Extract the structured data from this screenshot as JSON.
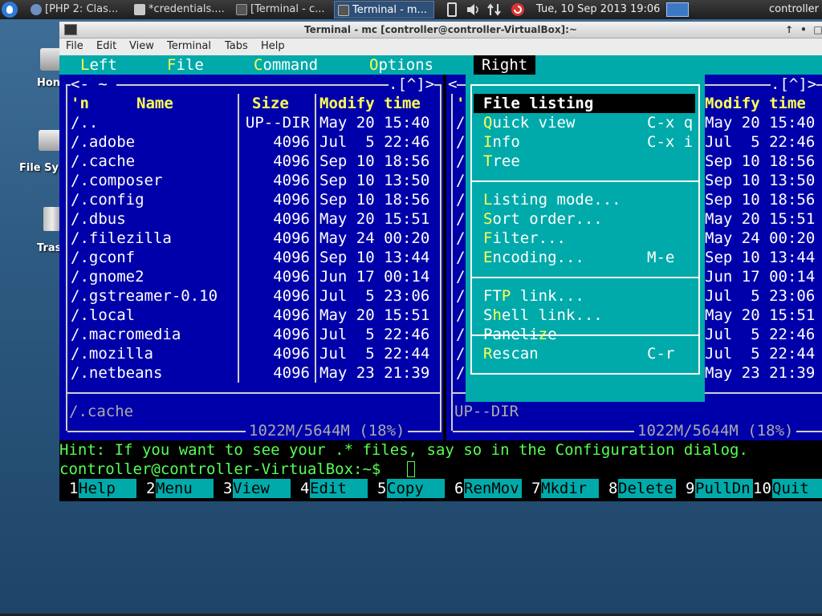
{
  "taskbar": {
    "tasks": [
      {
        "label": "[PHP 2: Clas...",
        "icon_color": "#6e8fbf"
      },
      {
        "label": "*credentials....",
        "icon_color": "#c9c9c9"
      },
      {
        "label": "[Terminal - c...",
        "icon_color": "#555555"
      },
      {
        "label": "Terminal - m...",
        "icon_color": "#555555"
      }
    ],
    "clock": "Tue, 10 Sep 2013 19:06",
    "user": "controller"
  },
  "desktop": {
    "icons": [
      {
        "label": "Hon",
        "icon": "home-folder-icon"
      },
      {
        "label": "File Sy",
        "icon": "drive-icon"
      },
      {
        "label": "Tras",
        "icon": "trash-icon"
      }
    ]
  },
  "window": {
    "title": "Terminal - mc [controller@controller-VirtualBox]:~",
    "menu": [
      "File",
      "Edit",
      "View",
      "Terminal",
      "Tabs",
      "Help"
    ]
  },
  "mc": {
    "menubar": [
      {
        "hot": "L",
        "rest": "eft"
      },
      {
        "hot": "F",
        "rest": "ile"
      },
      {
        "hot": "C",
        "rest": "ommand"
      },
      {
        "hot": "O",
        "rest": "ptions"
      },
      {
        "hot": "",
        "rest": "Right"
      }
    ],
    "left_panel": {
      "header_left": "<- ~ ",
      "header_right": ".[^]>",
      "col_n": "'n",
      "col_name": "Name",
      "col_size": "Size",
      "col_time": "Modify time",
      "files": [
        {
          "name": "/..",
          "size": "UP--DIR",
          "time": "May 20 15:40"
        },
        {
          "name": "/.adobe",
          "size": "4096",
          "time": "Jul  5 22:46"
        },
        {
          "name": "/.cache",
          "size": "4096",
          "time": "Sep 10 18:56"
        },
        {
          "name": "/.composer",
          "size": "4096",
          "time": "Sep 10 13:50"
        },
        {
          "name": "/.config",
          "size": "4096",
          "time": "Sep 10 18:56"
        },
        {
          "name": "/.dbus",
          "size": "4096",
          "time": "May 20 15:51"
        },
        {
          "name": "/.filezilla",
          "size": "4096",
          "time": "May 24 00:20"
        },
        {
          "name": "/.gconf",
          "size": "4096",
          "time": "Sep 10 13:44"
        },
        {
          "name": "/.gnome2",
          "size": "4096",
          "time": "Jun 17 00:14"
        },
        {
          "name": "/.gstreamer-0.10",
          "size": "4096",
          "time": "Jul  5 23:06"
        },
        {
          "name": "/.local",
          "size": "4096",
          "time": "May 20 15:51"
        },
        {
          "name": "/.macromedia",
          "size": "4096",
          "time": "Jul  5 22:46"
        },
        {
          "name": "/.mozilla",
          "size": "4096",
          "time": "Jul  5 22:44"
        },
        {
          "name": "/.netbeans",
          "size": "4096",
          "time": "May 23 21:39"
        }
      ],
      "status": "/.cache",
      "disk": "1022M/5644M (18%)"
    },
    "right_panel": {
      "header_left": "<",
      "header_right": ".[^]>",
      "col_n": "'",
      "col_time": "Modify time",
      "slashes": [
        "/",
        "/",
        "/",
        "/",
        "/",
        "/",
        "/",
        "/",
        "/",
        "/",
        "/",
        "/",
        "/",
        "/"
      ],
      "times": [
        "May 20 15:40",
        "Jul  5 22:46",
        "Sep 10 18:56",
        "Sep 10 13:50",
        "Sep 10 18:56",
        "May 20 15:51",
        "May 24 00:20",
        "Sep 10 13:44",
        "Jun 17 00:14",
        "Jul  5 23:06",
        "May 20 15:51",
        "Jul  5 22:46",
        "Jul  5 22:44",
        "May 23 21:39"
      ],
      "status": "UP--DIR",
      "disk": "1022M/5644M (18%)"
    },
    "dropdown": {
      "groups": [
        [
          {
            "hot": "",
            "pre": "File listin",
            "post": "g",
            "hotmid": "",
            "shortcut": "",
            "selected": true
          },
          {
            "hot": "Q",
            "pre": "",
            "post": "uick view",
            "shortcut": "C-x q"
          },
          {
            "hot": "I",
            "pre": "",
            "post": "nfo",
            "shortcut": "C-x i"
          },
          {
            "hot": "T",
            "pre": "",
            "post": "ree",
            "shortcut": ""
          }
        ],
        [
          {
            "hot": "L",
            "pre": "",
            "post": "isting mode...",
            "shortcut": ""
          },
          {
            "hot": "S",
            "pre": "",
            "post": "ort order...",
            "shortcut": ""
          },
          {
            "hot": "F",
            "pre": "",
            "post": "ilter...",
            "shortcut": ""
          },
          {
            "hot": "E",
            "pre": "",
            "post": "ncoding...",
            "shortcut": "M-e"
          }
        ],
        [
          {
            "hot": "P",
            "pre": "FT",
            "post": " link...",
            "shortcut": ""
          },
          {
            "hot": "h",
            "pre": "S",
            "post": "ell link...",
            "shortcut": ""
          },
          {
            "hot": "z",
            "pre": "Paneli",
            "post": "e",
            "shortcut": ""
          }
        ],
        [
          {
            "hot": "R",
            "pre": "",
            "post": "escan",
            "shortcut": "C-r"
          }
        ]
      ]
    },
    "hint": "Hint: If you want to see your .* files, say so in the Configuration dialog.",
    "prompt": "controller@controller-VirtualBox:~$ ",
    "fkeys": [
      {
        "num": "1",
        "label": "Help"
      },
      {
        "num": "2",
        "label": "Menu"
      },
      {
        "num": "3",
        "label": "View"
      },
      {
        "num": "4",
        "label": "Edit"
      },
      {
        "num": "5",
        "label": "Copy"
      },
      {
        "num": "6",
        "label": "RenMov"
      },
      {
        "num": "7",
        "label": "Mkdir"
      },
      {
        "num": "8",
        "label": "Delete"
      },
      {
        "num": "9",
        "label": "PullDn"
      },
      {
        "num": "10",
        "label": "Quit"
      }
    ]
  }
}
